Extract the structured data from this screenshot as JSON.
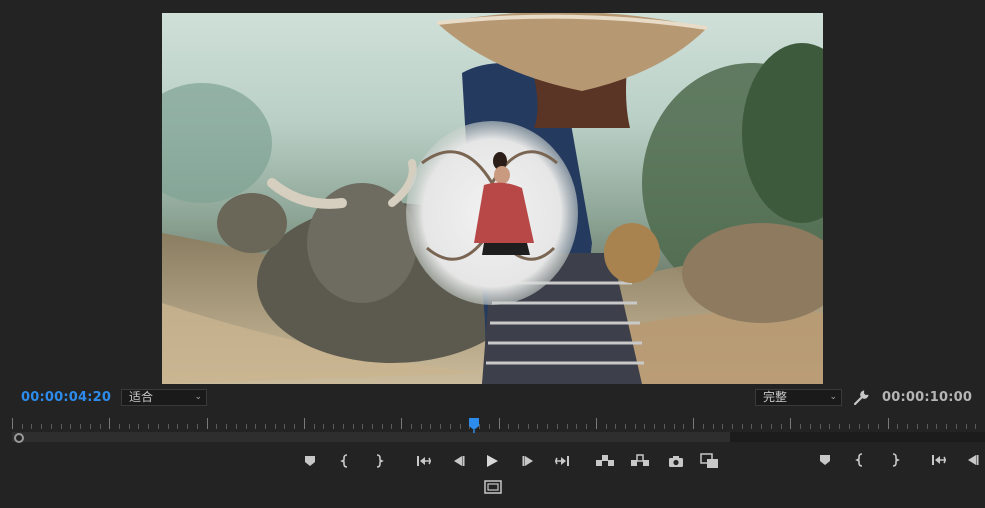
{
  "viewer": {
    "timecode_current": "00:00:04:20",
    "timecode_duration": "00:00:10:00",
    "fit_dropdown": {
      "value": "适合"
    },
    "quality_dropdown": {
      "value": "完整"
    }
  },
  "colors": {
    "accent": "#2d8ceb",
    "panel_bg": "#232323",
    "icon": "#c8c8c8"
  },
  "controls": {
    "main": [
      "marker-icon",
      "mark-in-icon",
      "mark-out-icon",
      "go-to-in-icon",
      "step-back-icon",
      "play-icon",
      "step-forward-icon",
      "go-to-out-icon",
      "lift-icon",
      "extract-icon",
      "export-frame-icon",
      "comparison-view-icon"
    ],
    "secondary": [
      "safe-margins-icon"
    ],
    "right": [
      "marker-icon",
      "mark-in-icon",
      "mark-out-icon",
      "go-to-in-icon",
      "step-back-icon"
    ]
  }
}
